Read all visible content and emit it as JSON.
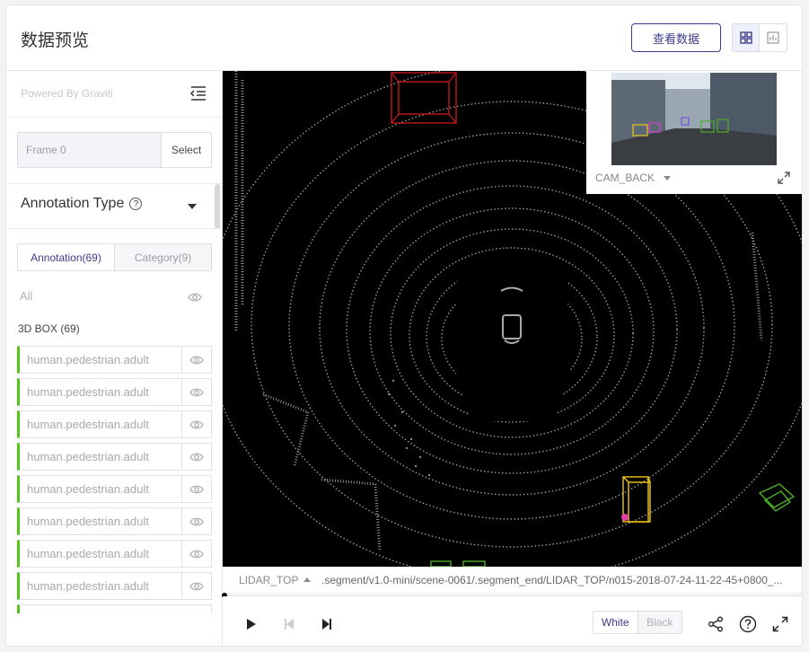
{
  "header": {
    "title": "数据预览",
    "view_data_button": "查看数据",
    "view_modes": [
      {
        "icon": "grid-view-icon",
        "active": true
      },
      {
        "icon": "chart-view-icon",
        "active": false
      }
    ]
  },
  "sidebar": {
    "powered_by": "Powered By Graviti",
    "frame_input_placeholder": "Frame 0",
    "select_button": "Select",
    "annotation_type_label": "Annotation Type",
    "help_symbol": "?",
    "tabs": [
      {
        "label": "Annotation(69)",
        "active": true
      },
      {
        "label": "Category(9)",
        "active": false
      }
    ],
    "all_label": "All",
    "box_section_label": "3D BOX (69)",
    "items": [
      {
        "label": "human.pedestrian.adult"
      },
      {
        "label": "human.pedestrian.adult"
      },
      {
        "label": "human.pedestrian.adult"
      },
      {
        "label": "human.pedestrian.adult"
      },
      {
        "label": "human.pedestrian.adult"
      },
      {
        "label": "human.pedestrian.adult"
      },
      {
        "label": "human.pedestrian.adult"
      },
      {
        "label": "human.pedestrian.adult"
      }
    ]
  },
  "viewer": {
    "camera_label": "CAM_BACK",
    "sensor_label": "LIDAR_TOP",
    "file_path": ".segment/v1.0-mini/scene-0061/.segment_end/LIDAR_TOP/n015-2018-07-24-11-22-45+0800_..."
  },
  "controls": {
    "theme_options": [
      {
        "label": "White",
        "active": true
      },
      {
        "label": "Black",
        "active": false
      }
    ]
  },
  "colors": {
    "accent": "#3d3b8e",
    "annotation_green": "#52c41a",
    "box_red": "#c0181c",
    "box_yellow": "#f0c419",
    "box_green": "#4caf28"
  }
}
